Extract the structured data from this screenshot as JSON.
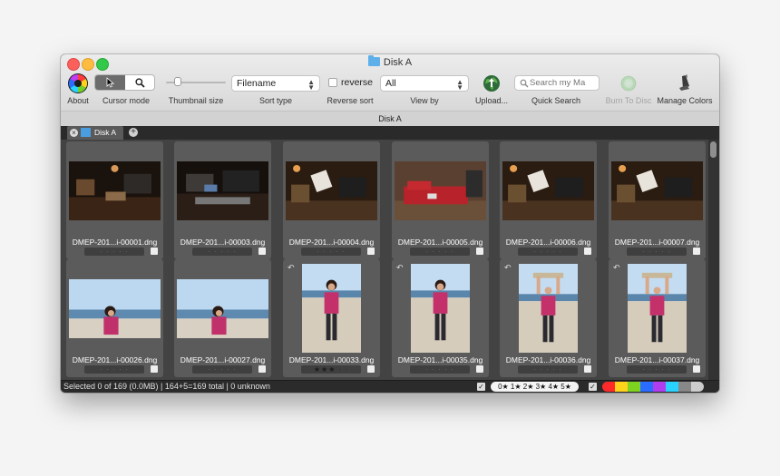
{
  "window": {
    "title": "Disk A",
    "subtitle": "Disk A"
  },
  "toolbar": {
    "about_label": "About",
    "cursor_mode_label": "Cursor mode",
    "thumbnail_size_label": "Thumbnail size",
    "thumbnail_size_value": 0.15,
    "sort_type_label": "Sort type",
    "sort_type_value": "Filename",
    "reverse_label": "reverse",
    "reverse_sort_label": "Reverse sort",
    "view_by_label": "View by",
    "view_by_value": "All",
    "upload_label": "Upload...",
    "quick_search_label": "Quick Search",
    "quick_search_placeholder": "Search my Ma",
    "burn_label": "Burn To Disc",
    "manage_colors_label": "Manage Colors"
  },
  "tabs": [
    {
      "label": "Disk A"
    }
  ],
  "files": [
    {
      "name": "DMEP-201...i-00001.dng",
      "stars": "· · · · ·",
      "rated": false,
      "rotated": false,
      "scene": "studio"
    },
    {
      "name": "DMEP-201...i-00003.dng",
      "stars": "· · · · ·",
      "rated": false,
      "rotated": false,
      "scene": "studio2"
    },
    {
      "name": "DMEP-201...i-00004.dng",
      "stars": "· · · · ·",
      "rated": false,
      "rotated": false,
      "scene": "studio3"
    },
    {
      "name": "DMEP-201...i-00005.dng",
      "stars": "· · · · ·",
      "rated": false,
      "rotated": false,
      "scene": "couch"
    },
    {
      "name": "DMEP-201...i-00006.dng",
      "stars": "· · · · ·",
      "rated": false,
      "rotated": false,
      "scene": "studio3"
    },
    {
      "name": "DMEP-201...i-00007.dng",
      "stars": "· · · · ·",
      "rated": false,
      "rotated": false,
      "scene": "studio3"
    },
    {
      "name": "DMEP-201...i-00026.dng",
      "stars": "· · · · ·",
      "rated": false,
      "rotated": false,
      "scene": "beach-land"
    },
    {
      "name": "DMEP-201...i-00027.dng",
      "stars": "· · · · ·",
      "rated": false,
      "rotated": false,
      "scene": "beach-land"
    },
    {
      "name": "DMEP-201...i-00033.dng",
      "stars": "★★★ · ·",
      "rated": true,
      "rotated": true,
      "scene": "beach-port"
    },
    {
      "name": "DMEP-201...i-00035.dng",
      "stars": "· · · · ·",
      "rated": false,
      "rotated": true,
      "scene": "beach-port"
    },
    {
      "name": "DMEP-201...i-00036.dng",
      "stars": "· · · · ·",
      "rated": false,
      "rotated": true,
      "scene": "beach-arms"
    },
    {
      "name": "DMEP-201...i-00037.dng",
      "stars": "· · · · ·",
      "rated": false,
      "rotated": true,
      "scene": "beach-arms"
    }
  ],
  "status": {
    "text": "Selected 0 of 169 (0.0MB) | 164+5=169 total | 0 unknown",
    "rating_filter": "0★ 1★ 2★ 3★ 4★ 5★",
    "checkmark": "✓"
  },
  "colors": {
    "label_strip": [
      "#ff2a2a",
      "#ffd21c",
      "#7ed321",
      "#2a6cff",
      "#b13df0",
      "#2ad3ff",
      "#888888",
      "#cccccc"
    ]
  },
  "icons": {
    "about": "color-wheel-icon",
    "pointer": "arrow-cursor-icon",
    "zoom": "magnifier-icon",
    "upload": "globe-upload-icon",
    "search": "search-icon",
    "burn": "disc-icon",
    "manage_colors": "color-brush-icon",
    "rotate": "rotate-icon"
  }
}
